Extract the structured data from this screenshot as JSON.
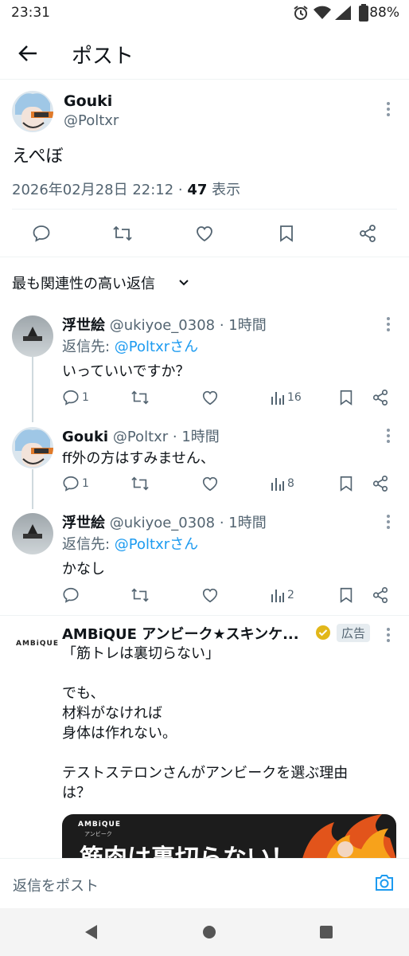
{
  "status_bar": {
    "time": "23:31",
    "battery": "88%"
  },
  "header": {
    "title": "ポスト"
  },
  "post": {
    "display_name": "Gouki",
    "handle": "@Poltxr",
    "text": "えぺぼ",
    "timestamp": "2026年02月28日 22:12 · ",
    "views_count": "47",
    "views_label": " 表示"
  },
  "sort": {
    "label": "最も関連性の高い返信"
  },
  "replies": [
    {
      "name": "浮世絵",
      "meta": "@ukiyoe_0308 · 1時間",
      "reply_to_prefix": "返信先: ",
      "reply_to_handle": "@Poltxrさん",
      "text": "いっていいですか？",
      "reply_count": "1",
      "views": "16"
    },
    {
      "name": "Gouki",
      "meta": "@Poltxr · 1時間",
      "text": "ff外の方はすみません、",
      "reply_count": "1",
      "views": "8"
    },
    {
      "name": "浮世絵",
      "meta": "@ukiyoe_0308 · 1時間",
      "reply_to_prefix": "返信先: ",
      "reply_to_handle": "@Poltxrさん",
      "text": "かなし",
      "reply_count": "",
      "views": "2"
    }
  ],
  "ad": {
    "name": "AMBiQUE アンビーク★スキンケ...",
    "badge": "広告",
    "logo_text": "AMBiQUE",
    "text": "「筋トレは裏切らない」\n\nでも、\n材料がなければ\n身体は作れない。\n\nテストステロンさんがアンビークを選ぶ理由\nは？",
    "banner_logo": "AMBiQUE",
    "banner_sub": "アンビーク",
    "banner_text": "筋肉は裏切らない！"
  },
  "composer": {
    "placeholder": "返信をポスト"
  },
  "colors": {
    "accent": "#1d9bf0",
    "text": "#0f1419",
    "muted": "#536471",
    "verified": "#e2b719"
  }
}
